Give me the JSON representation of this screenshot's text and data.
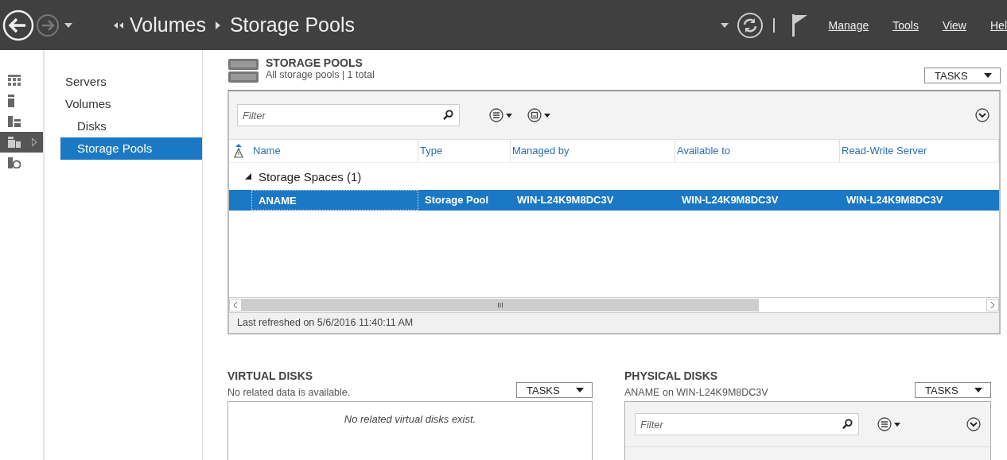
{
  "breadcrumb": [
    "Volumes",
    "Storage Pools"
  ],
  "menu": [
    "Manage",
    "Tools",
    "View",
    "Hel"
  ],
  "rail": [
    {
      "selected": false
    },
    {
      "selected": false
    },
    {
      "selected": false
    },
    {
      "selected": true
    },
    {
      "selected": false
    }
  ],
  "nav": [
    {
      "label": "Servers",
      "selected": false
    },
    {
      "label": "Volumes",
      "selected": false,
      "children": [
        {
          "label": "Disks",
          "selected": false
        },
        {
          "label": "Storage Pools",
          "selected": true
        }
      ]
    }
  ],
  "storage_pools": {
    "title": "STORAGE POOLS",
    "subtitle": "All storage pools | 1 total",
    "tasks": "TASKS",
    "filter_placeholder": "Filter",
    "columns": [
      "Name",
      "Type",
      "Managed by",
      "Available to",
      "Read-Write Server"
    ],
    "group": "Storage Spaces (1)",
    "rows": [
      {
        "cells": [
          "ANAME",
          "Storage Pool",
          "WIN-L24K9M8DC3V",
          "WIN-L24K9M8DC3V",
          "WIN-L24K9M8DC3V"
        ],
        "selected": true
      }
    ],
    "scroll_grip": "III",
    "status": "Last refreshed on 5/6/2016 11:40:11 AM"
  },
  "virtual_disks": {
    "title": "VIRTUAL DISKS",
    "subtitle": "No related data is available.",
    "tasks": "TASKS",
    "empty": "No related virtual disks exist."
  },
  "physical_disks": {
    "title": "PHYSICAL DISKS",
    "subtitle": "ANAME on WIN-L24K9M8DC3V",
    "tasks": "TASKS",
    "filter_placeholder": "Filter"
  }
}
